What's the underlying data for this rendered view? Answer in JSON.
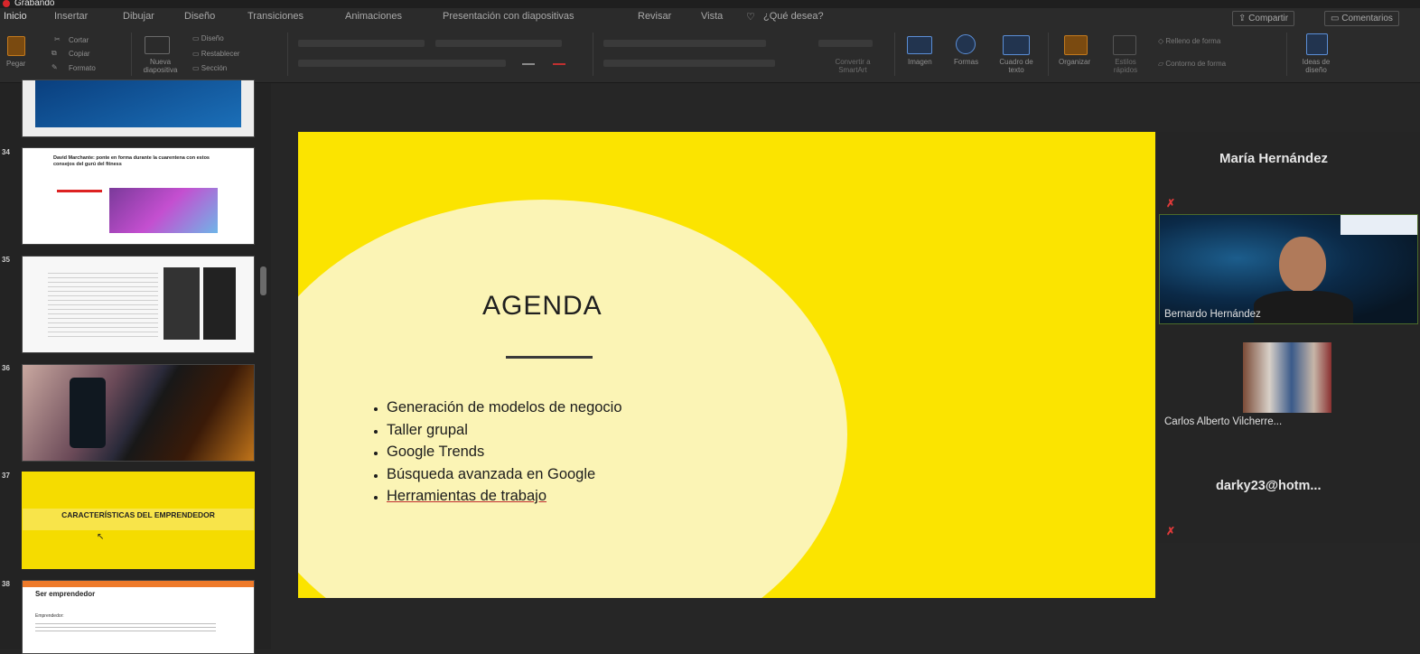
{
  "window": {
    "recording_label": "Grabando"
  },
  "menu": {
    "tabs": [
      "Inicio",
      "Insertar",
      "Dibujar",
      "Diseño",
      "Transiciones",
      "Animaciones",
      "Presentación con diapositivas",
      "Revisar",
      "Vista"
    ],
    "search_prompt": "¿Qué desea?",
    "share_label": "Compartir",
    "comments_label": "Comentarios"
  },
  "ribbon": {
    "paste": "Pegar",
    "cut": "Cortar",
    "copy": "Copiar",
    "format": "Formato",
    "new_slide": "Nueva diapositiva",
    "layout": "Diseño",
    "reset": "Restablecer",
    "section": "Sección",
    "convert_smartart": "Convertir a SmartArt",
    "image": "Imagen",
    "shapes": "Formas",
    "textbox": "Cuadro de texto",
    "arrange": "Organizar",
    "quick_styles": "Estilos rápidos",
    "shape_fill": "Relleno de forma",
    "shape_outline": "Contorno de forma",
    "design_ideas": "Ideas de diseño"
  },
  "thumbnails": {
    "numbers": [
      "34",
      "35",
      "36",
      "37",
      "38"
    ],
    "slide_34_headline": "David Marchante: ponte en forma durante la cuarentena con estos consejos del gurú del fitness",
    "slide_37_title": "CARACTERÍSTICAS DEL EMPRENDEDOR",
    "slide_38_title": "Ser emprendedor",
    "slide_38_sub": "Emprendedor:"
  },
  "slide": {
    "title": "AGENDA",
    "items": [
      "Generación de modelos de negocio",
      "Taller grupal",
      "Google Trends",
      "Búsqueda avanzada en Google",
      "Herramientas de trabajo"
    ]
  },
  "participants": {
    "p1": "María Hernández",
    "p2": "Bernardo Hernández",
    "p3": "Carlos Alberto Vilcherre...",
    "p4": "darky23@hotm..."
  },
  "colors": {
    "slide_yellow": "#fbe400",
    "circle_cream": "#fbf4b5",
    "mic_off": "#e03a3a"
  }
}
